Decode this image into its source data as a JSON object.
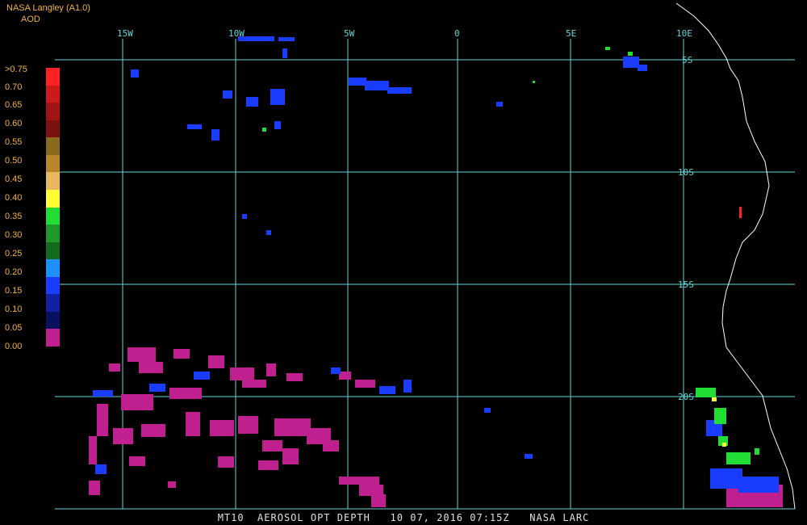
{
  "header": {
    "source": "NASA Langley (A1.0)",
    "product": "AOD"
  },
  "map": {
    "longitude_labels": [
      "15W",
      "10W",
      "5W",
      "0",
      "5E",
      "10E"
    ],
    "latitude_labels": [
      "5S",
      "10S",
      "15S",
      "20S"
    ],
    "grid_color": "#5fd7d7",
    "coast_color": "#ffffff"
  },
  "legend": {
    "labels": [
      ">0.75",
      "0.70",
      "0.65",
      "0.60",
      "0.55",
      "0.50",
      "0.45",
      "0.40",
      "0.35",
      "0.30",
      "0.25",
      "0.20",
      "0.15",
      "0.10",
      "0.05",
      "0.00"
    ],
    "colors": [
      "#ff2222",
      "#cc1a1a",
      "#a01414",
      "#7a1010",
      "#8a6a1c",
      "#b8862a",
      "#e8b860",
      "#ffff33",
      "#22dd33",
      "#1f9a2a",
      "#146a1e",
      "#1e90ff",
      "#1a3cff",
      "#1020a0",
      "#0a1060",
      "#c0208f"
    ]
  },
  "footer": {
    "text": "MT10  AEROSOL OPT DEPTH   10 07, 2016 07:15Z   NASA LARC"
  }
}
